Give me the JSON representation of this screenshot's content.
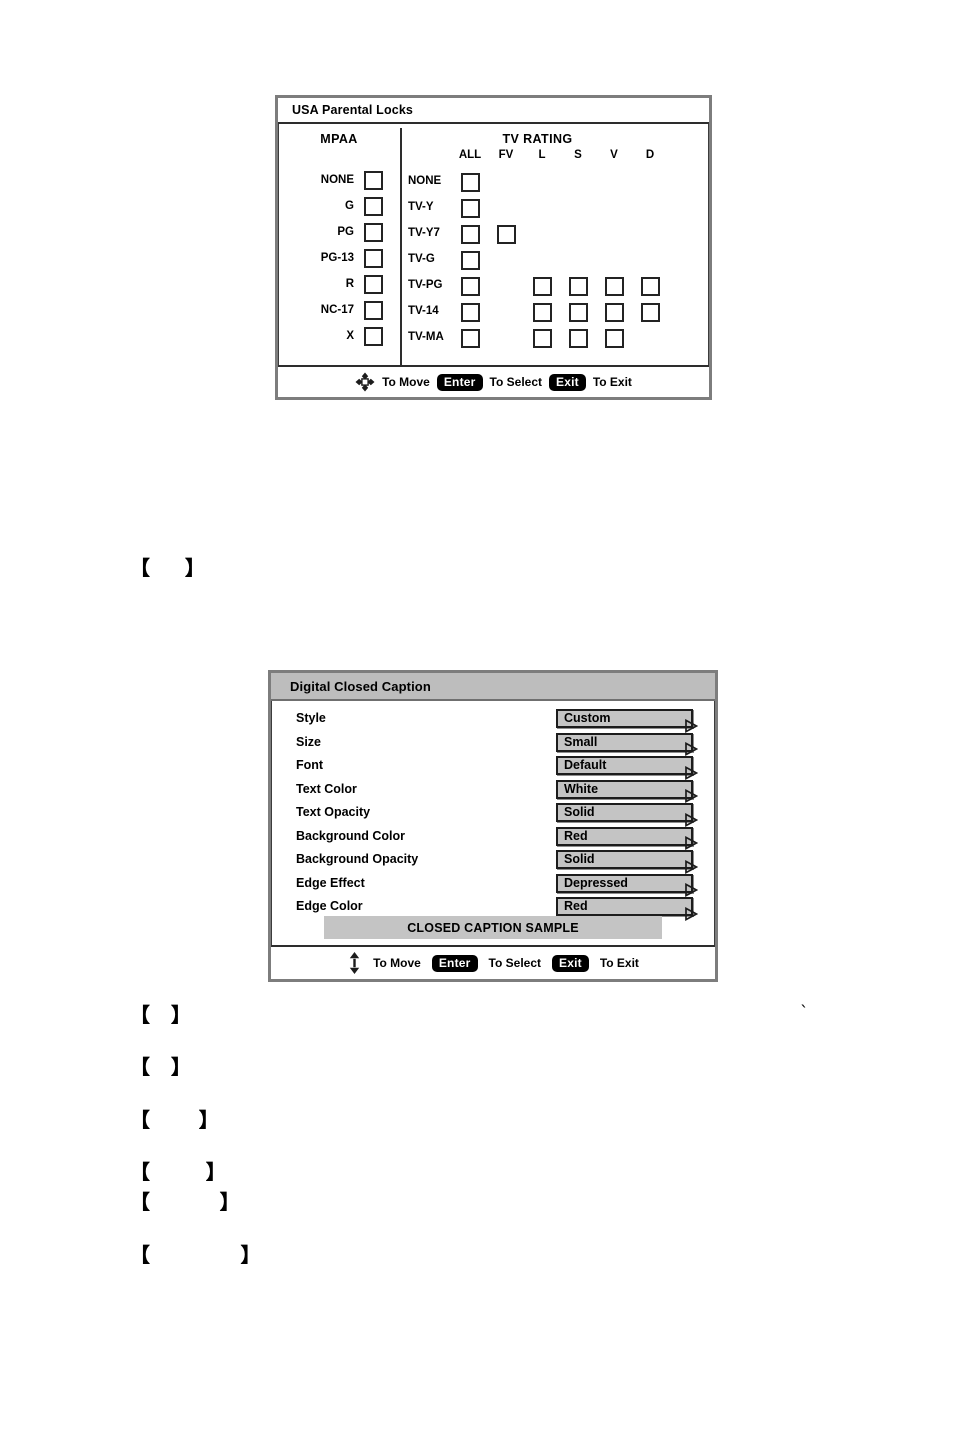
{
  "parental_panel": {
    "title": "USA Parental Locks",
    "mpaa": {
      "heading": "MPAA",
      "ratings": [
        "NONE",
        "G",
        "PG",
        "PG-13",
        "R",
        "NC-17",
        "X"
      ]
    },
    "tv_rating": {
      "heading": "TV RATING",
      "columns": [
        "ALL",
        "FV",
        "L",
        "S",
        "V",
        "D"
      ],
      "rows": [
        {
          "label": "NONE",
          "checkboxes": [
            "ALL"
          ]
        },
        {
          "label": "TV-Y",
          "checkboxes": [
            "ALL"
          ]
        },
        {
          "label": "TV-Y7",
          "checkboxes": [
            "ALL",
            "FV"
          ]
        },
        {
          "label": "TV-G",
          "checkboxes": [
            "ALL"
          ]
        },
        {
          "label": "TV-PG",
          "checkboxes": [
            "ALL",
            "L",
            "S",
            "V",
            "D"
          ]
        },
        {
          "label": "TV-14",
          "checkboxes": [
            "ALL",
            "L",
            "S",
            "V",
            "D"
          ]
        },
        {
          "label": "TV-MA",
          "checkboxes": [
            "ALL",
            "L",
            "S",
            "V"
          ]
        }
      ]
    },
    "hints": {
      "move_icon": "dpad-icon",
      "move_text": "To Move",
      "enter_key": "Enter",
      "select_text": "To Select",
      "exit_key": "Exit",
      "exit_text": "To Exit"
    }
  },
  "dcc_panel": {
    "title": "Digital Closed Caption",
    "rows": [
      {
        "label": "Style",
        "value": "Custom"
      },
      {
        "label": "Size",
        "value": "Small"
      },
      {
        "label": "Font",
        "value": "Default"
      },
      {
        "label": "Text Color",
        "value": "White"
      },
      {
        "label": "Text Opacity",
        "value": "Solid"
      },
      {
        "label": "Background Color",
        "value": "Red"
      },
      {
        "label": "Background Opacity",
        "value": "Solid"
      },
      {
        "label": "Edge Effect",
        "value": "Depressed"
      },
      {
        "label": "Edge Color",
        "value": "Red"
      }
    ],
    "sample_text": "CLOSED CAPTION SAMPLE",
    "hints": {
      "move_icon": "updown-arrows-icon",
      "move_text": "To Move",
      "enter_key": "Enter",
      "select_text": "To Select",
      "exit_key": "Exit",
      "exit_text": "To Exit"
    }
  },
  "body_text": {
    "brackets": [
      {
        "text": "【     】"
      },
      {
        "text": "【   】"
      },
      {
        "text": "【   】"
      },
      {
        "text": "【       】"
      },
      {
        "text": "【        】"
      },
      {
        "text": "【          】"
      },
      {
        "text": "【             】"
      }
    ],
    "tick": "`"
  },
  "colors": {
    "panel_border": "#7d7d7d",
    "panel_inner_border": "#3c3c3c",
    "titlebar_gray": "#bdbdbd",
    "value_box_gray": "#c4c4c4",
    "text": "#000000",
    "keycap_bg": "#000000",
    "keycap_text": "#ffffff"
  }
}
